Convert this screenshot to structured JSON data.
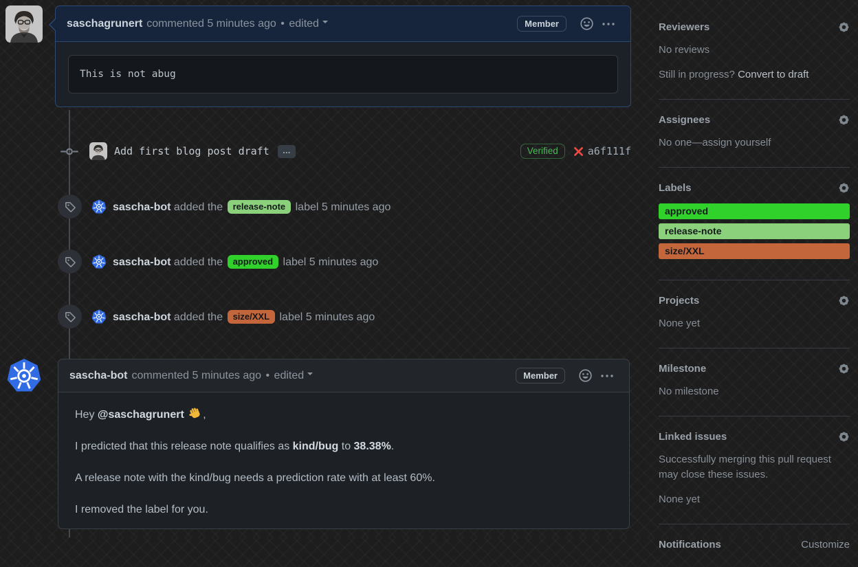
{
  "colors": {
    "k8s_blue": "#326ce5",
    "verified_green": "#4bb959",
    "failed_red": "#ee4b43",
    "label_approved": "#30d12a",
    "label_release_note": "#8bd17c",
    "label_size_xxl": "#c4663c",
    "comment1_accent_border": "#2c4a74"
  },
  "comment1": {
    "author": "saschagrunert",
    "action": "commented",
    "time": "5 minutes ago",
    "separator": "•",
    "edited_label": "edited",
    "member_badge": "Member",
    "code_text": "This is not abug"
  },
  "commit": {
    "message": "Add first blog post draft",
    "more_label": "…",
    "verified_label": "Verified",
    "status_icon": "x-icon",
    "hash": "a6f111f"
  },
  "label_events": [
    {
      "author": "sascha-bot",
      "action_pre": "added the",
      "label": "release-note",
      "color": "#8bd17c",
      "action_post": "label 5 minutes ago"
    },
    {
      "author": "sascha-bot",
      "action_pre": "added the",
      "label": "approved",
      "color": "#30d12a",
      "action_post": "label 5 minutes ago"
    },
    {
      "author": "sascha-bot",
      "action_pre": "added the",
      "label": "size/XXL",
      "color": "#c4663c",
      "action_post": "label 5 minutes ago"
    }
  ],
  "comment2": {
    "author": "sascha-bot",
    "action": "commented",
    "time": "5 minutes ago",
    "separator": "•",
    "edited_label": "edited",
    "member_badge": "Member",
    "paragraphs": [
      {
        "segments": [
          {
            "t": "Hey "
          },
          {
            "t": "@saschagrunert",
            "mention": true
          },
          {
            "t": " "
          },
          {
            "icon": "wave"
          },
          {
            "t": ","
          }
        ]
      },
      {
        "segments": [
          {
            "t": "I predicted that this release note qualifies as "
          },
          {
            "t": "kind/bug",
            "b": true
          },
          {
            "t": " to "
          },
          {
            "t": "38.38%",
            "b": true
          },
          {
            "t": "."
          }
        ]
      },
      {
        "segments": [
          {
            "t": "A release note with the kind/bug needs a prediction rate with at least 60%."
          }
        ]
      },
      {
        "segments": [
          {
            "t": "I removed the label for you."
          }
        ]
      }
    ]
  },
  "sidebar": {
    "sections": [
      {
        "id": "reviewers",
        "title": "Reviewers",
        "gear": true,
        "lines": [
          [
            {
              "t": "No reviews"
            }
          ],
          [
            {
              "t": "Still in progress? "
            },
            {
              "t": "Convert to draft",
              "link": true
            }
          ]
        ]
      },
      {
        "id": "assignees",
        "title": "Assignees",
        "gear": true,
        "lines": [
          [
            {
              "t": "No one—"
            },
            {
              "t": "assign yourself",
              "muted_link": true
            }
          ]
        ]
      },
      {
        "id": "labels",
        "title": "Labels",
        "gear": true,
        "labels": [
          {
            "text": "approved",
            "color": "#30d12a"
          },
          {
            "text": "release-note",
            "color": "#8bd17c"
          },
          {
            "text": "size/XXL",
            "color": "#c4663c"
          }
        ]
      },
      {
        "id": "projects",
        "title": "Projects",
        "gear": true,
        "lines": [
          [
            {
              "t": "None yet"
            }
          ]
        ]
      },
      {
        "id": "milestone",
        "title": "Milestone",
        "gear": true,
        "lines": [
          [
            {
              "t": "No milestone"
            }
          ]
        ]
      },
      {
        "id": "linked-issues",
        "title": "Linked issues",
        "gear": true,
        "lines": [
          [
            {
              "t": "Successfully merging this pull request may close these issues."
            }
          ],
          [
            {
              "t": "None yet"
            }
          ]
        ]
      },
      {
        "id": "notifications",
        "title": "Notifications",
        "gear": false,
        "header_link": "Customize"
      }
    ]
  }
}
